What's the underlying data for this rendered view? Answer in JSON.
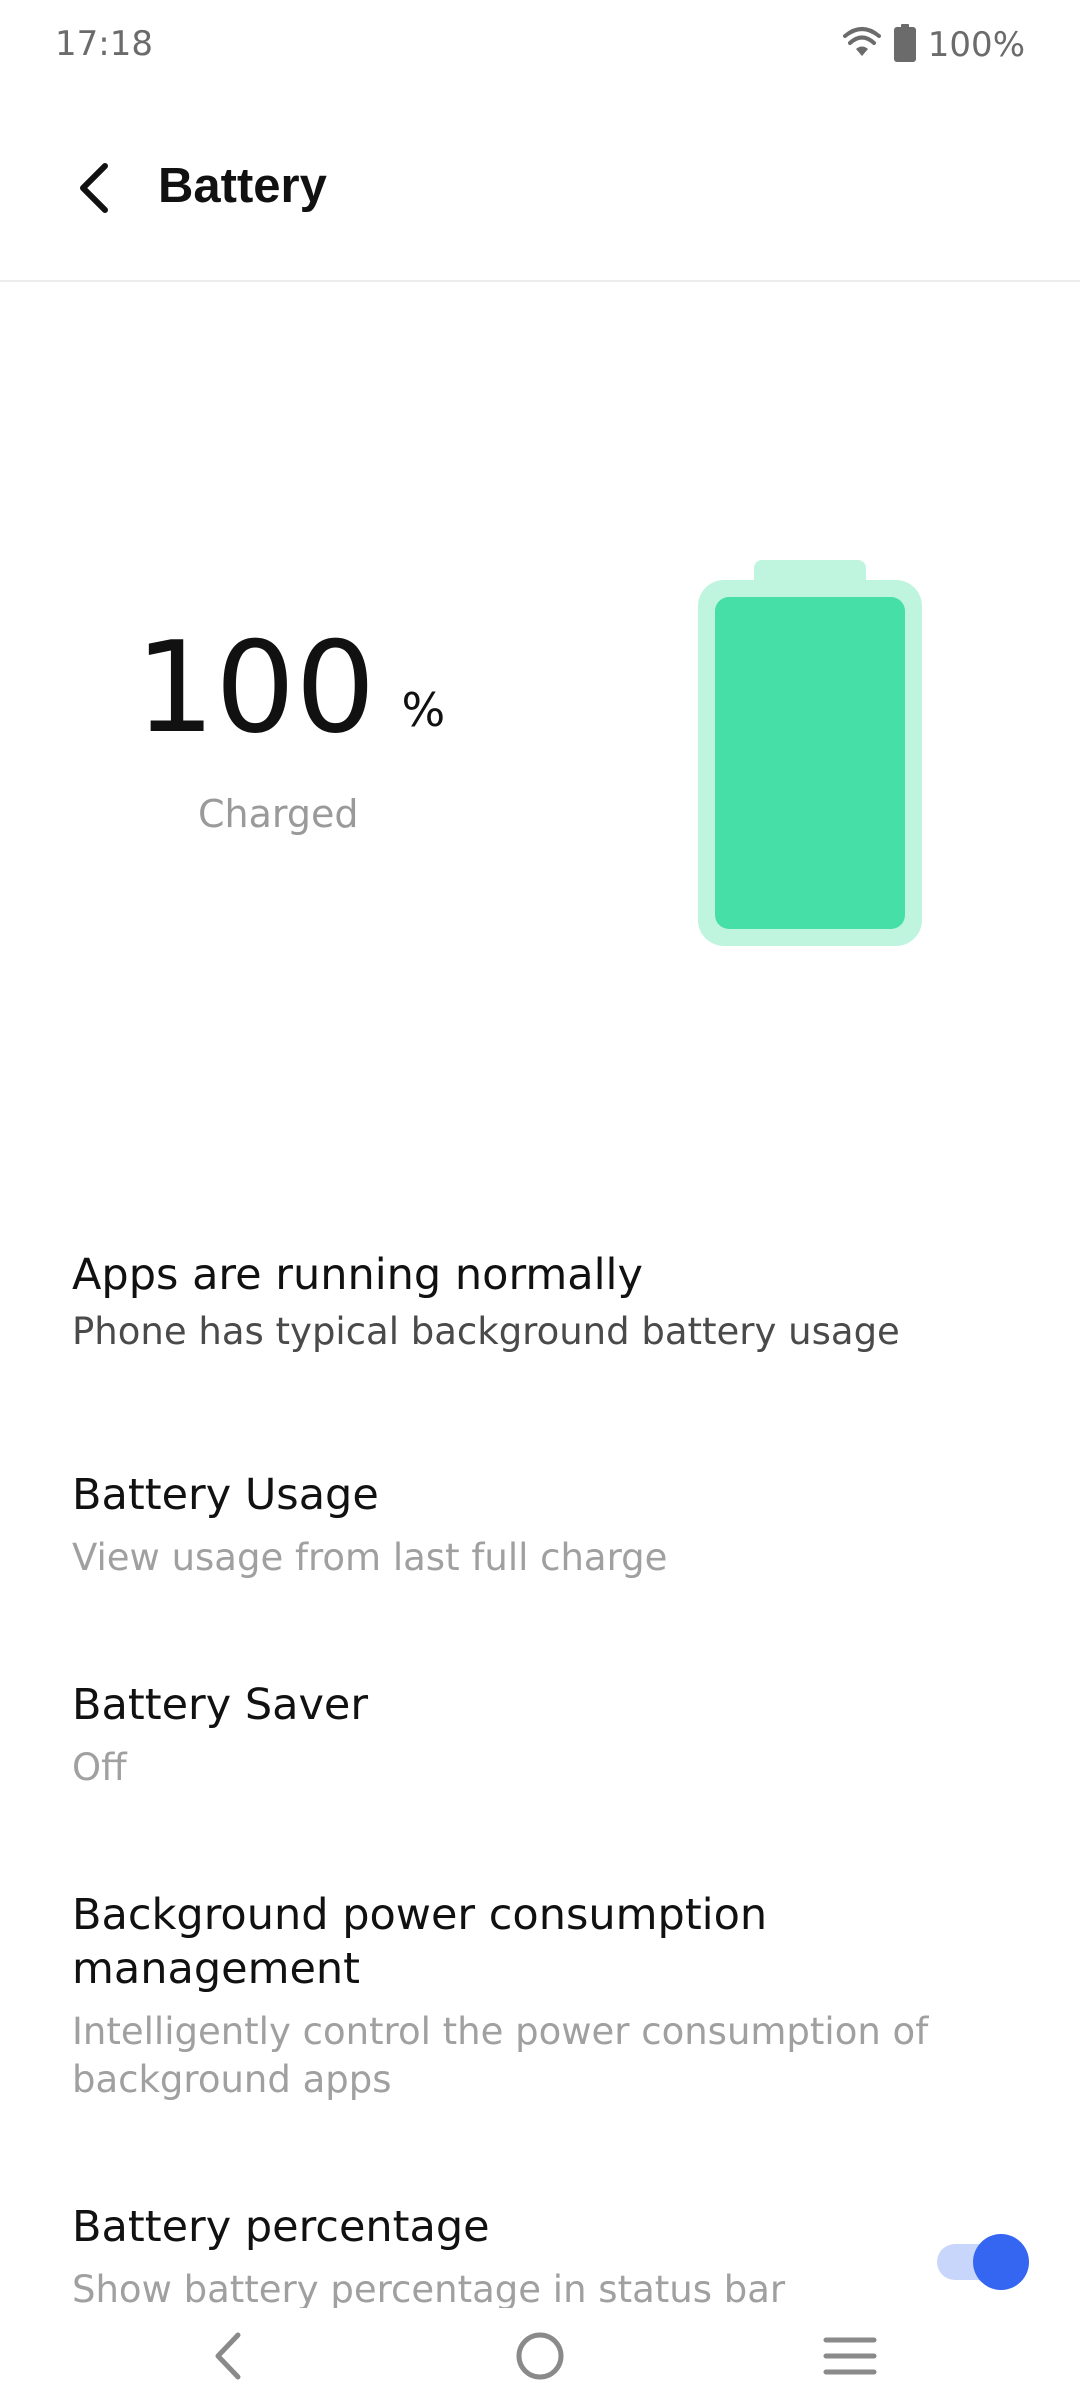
{
  "status_bar": {
    "time": "17:18",
    "battery_percent": "100%"
  },
  "header": {
    "title": "Battery"
  },
  "battery": {
    "level_value": "100",
    "unit": "%",
    "state": "Charged",
    "level_fraction": 1.0
  },
  "items": [
    {
      "title": "Apps are running normally",
      "subtitle": "Phone has typical background battery usage"
    },
    {
      "title": "Battery Usage",
      "subtitle": "View usage from last full charge"
    },
    {
      "title": "Battery Saver",
      "subtitle": "Off"
    },
    {
      "title": "Background power consumption management",
      "subtitle": "Intelligently control the power consumption of background apps"
    },
    {
      "title": "Battery percentage",
      "subtitle": "Show battery percentage in status bar",
      "toggle_on": true
    }
  ],
  "colors": {
    "battery_fill": "#46dfa8",
    "battery_shell": "#bff5de",
    "toggle_on": "#3566f1"
  },
  "icons": {
    "back": "chevron-left-icon",
    "wifi": "wifi-icon",
    "battery": "battery-icon",
    "nav_back": "nav-back-icon",
    "nav_home": "nav-home-icon",
    "nav_recents": "nav-recents-icon"
  }
}
